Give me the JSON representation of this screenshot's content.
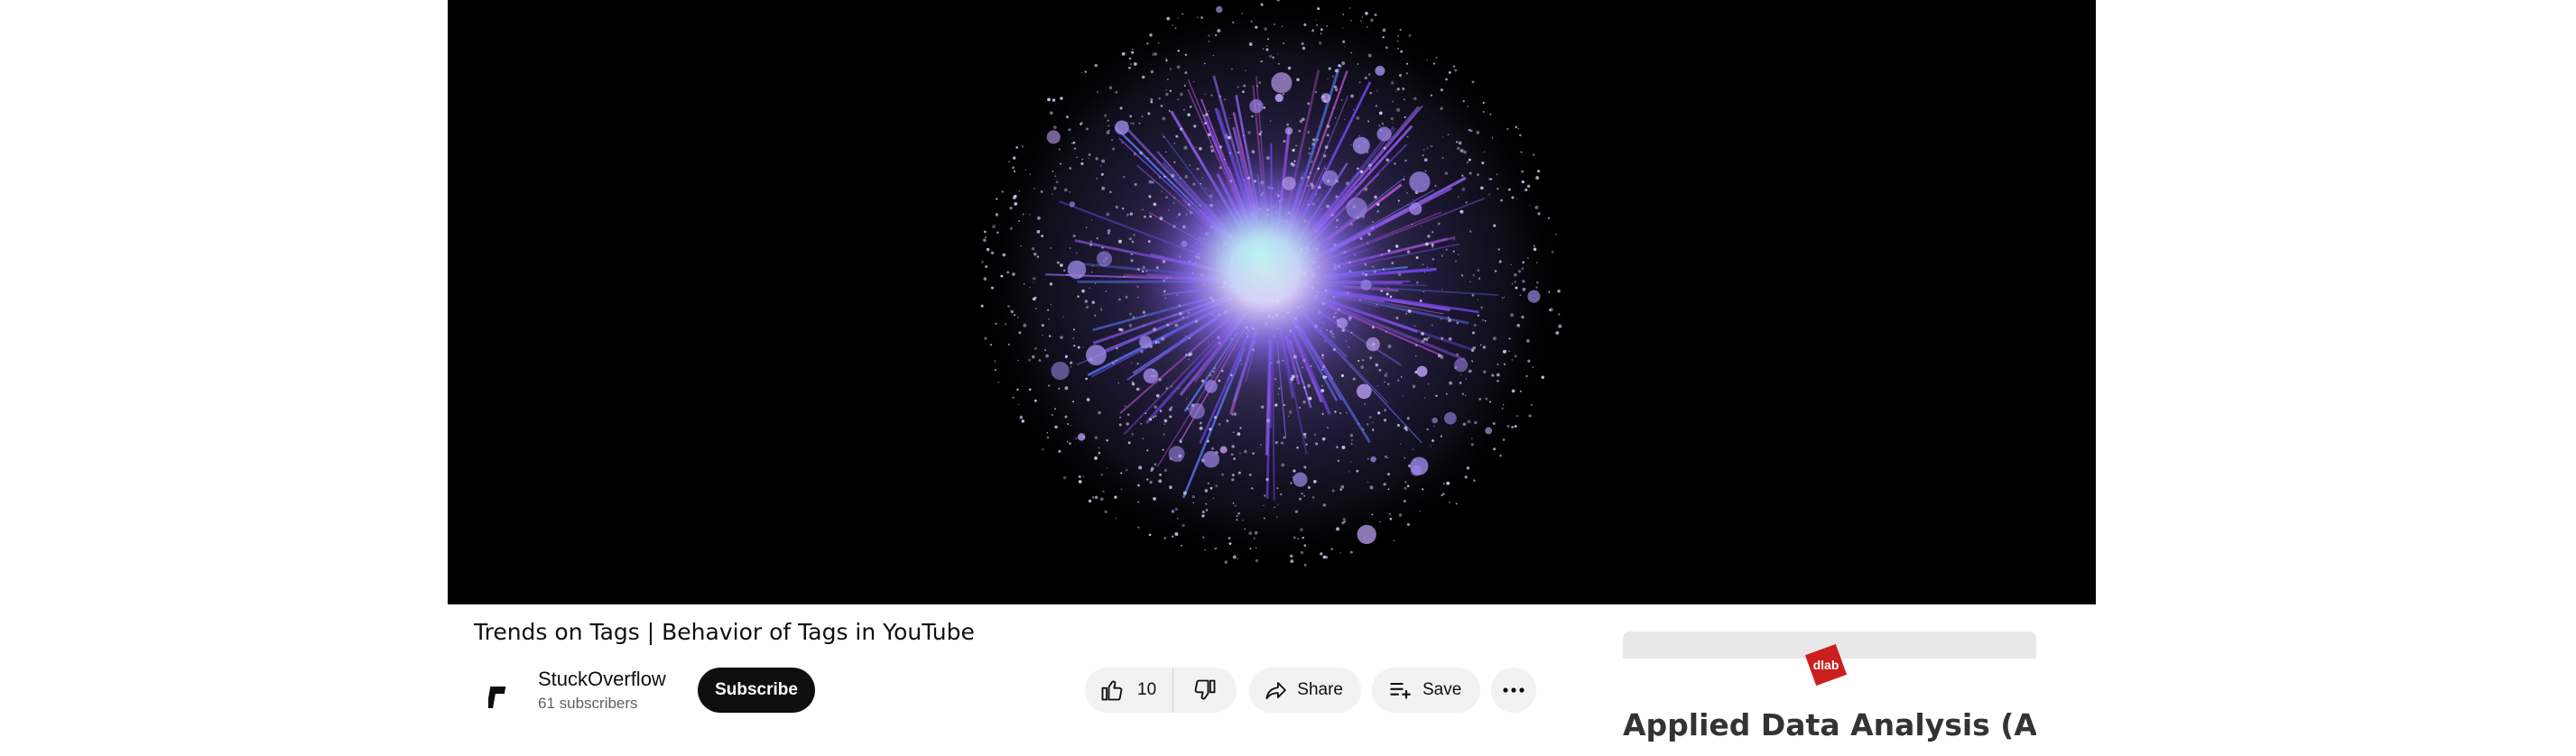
{
  "video": {
    "title": "Trends on Tags | Behavior of Tags in YouTube"
  },
  "channel": {
    "name": "StuckOverflow",
    "subscribers": "61 subscribers",
    "subscribe_label": "Subscribe"
  },
  "actions": {
    "like_count": "10",
    "share_label": "Share",
    "save_label": "Save",
    "icons": [
      "thumbs-up-icon",
      "thumbs-down-icon",
      "share-icon",
      "playlist-add-icon",
      "more-icon"
    ]
  },
  "side_card": {
    "logo_text": "dlab",
    "title": "Applied Data Analysis (ADA)"
  },
  "colors": {
    "subscribe_bg": "#0f0f0f",
    "pill_bg": "#f2f2f2",
    "logo_red": "#cc1f1f",
    "nebula_purple": "#8a5cf0"
  }
}
